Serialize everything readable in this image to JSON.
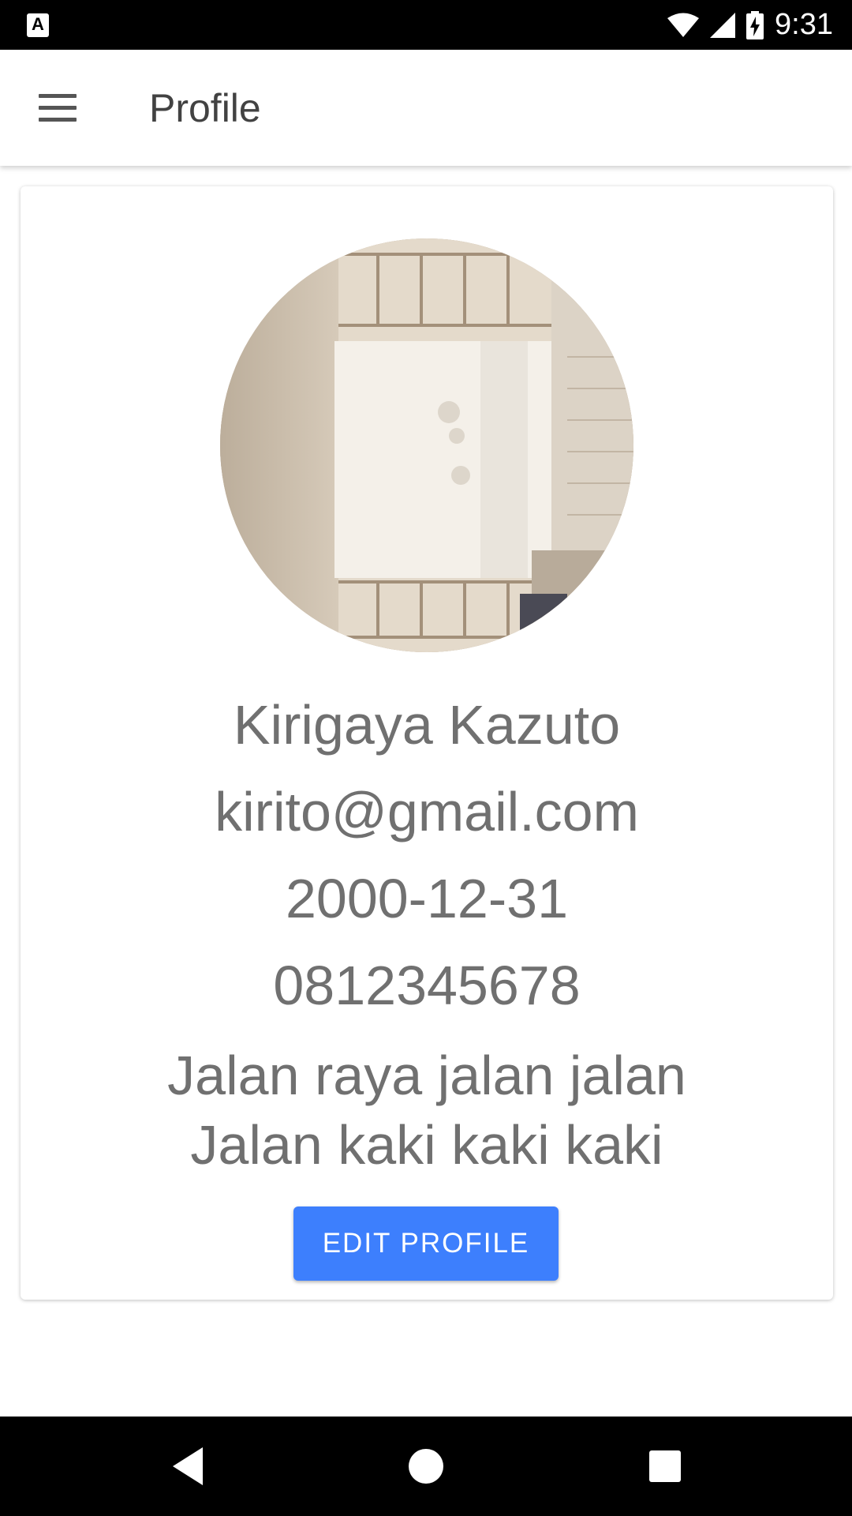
{
  "status_bar": {
    "notification_icon": "A",
    "wifi_icon": "wifi-icon",
    "signal_icon": "cell-signal-icon",
    "battery_icon": "battery-charging-icon",
    "time": "9:31"
  },
  "app_bar": {
    "menu_icon": "hamburger-menu-icon",
    "title": "Profile"
  },
  "profile": {
    "avatar_icon": "profile-photo",
    "name": "Kirigaya Kazuto",
    "email": "kirito@gmail.com",
    "birth_date": "2000-12-31",
    "phone": "0812345678",
    "address": "Jalan raya jalan jalan Jalan kaki kaki kaki",
    "edit_button_label": "EDIT PROFILE",
    "accent_color": "#3d7ffd"
  },
  "nav_bar": {
    "back_icon": "back-triangle-icon",
    "home_icon": "home-circle-icon",
    "recent_icon": "recent-apps-square-icon"
  }
}
